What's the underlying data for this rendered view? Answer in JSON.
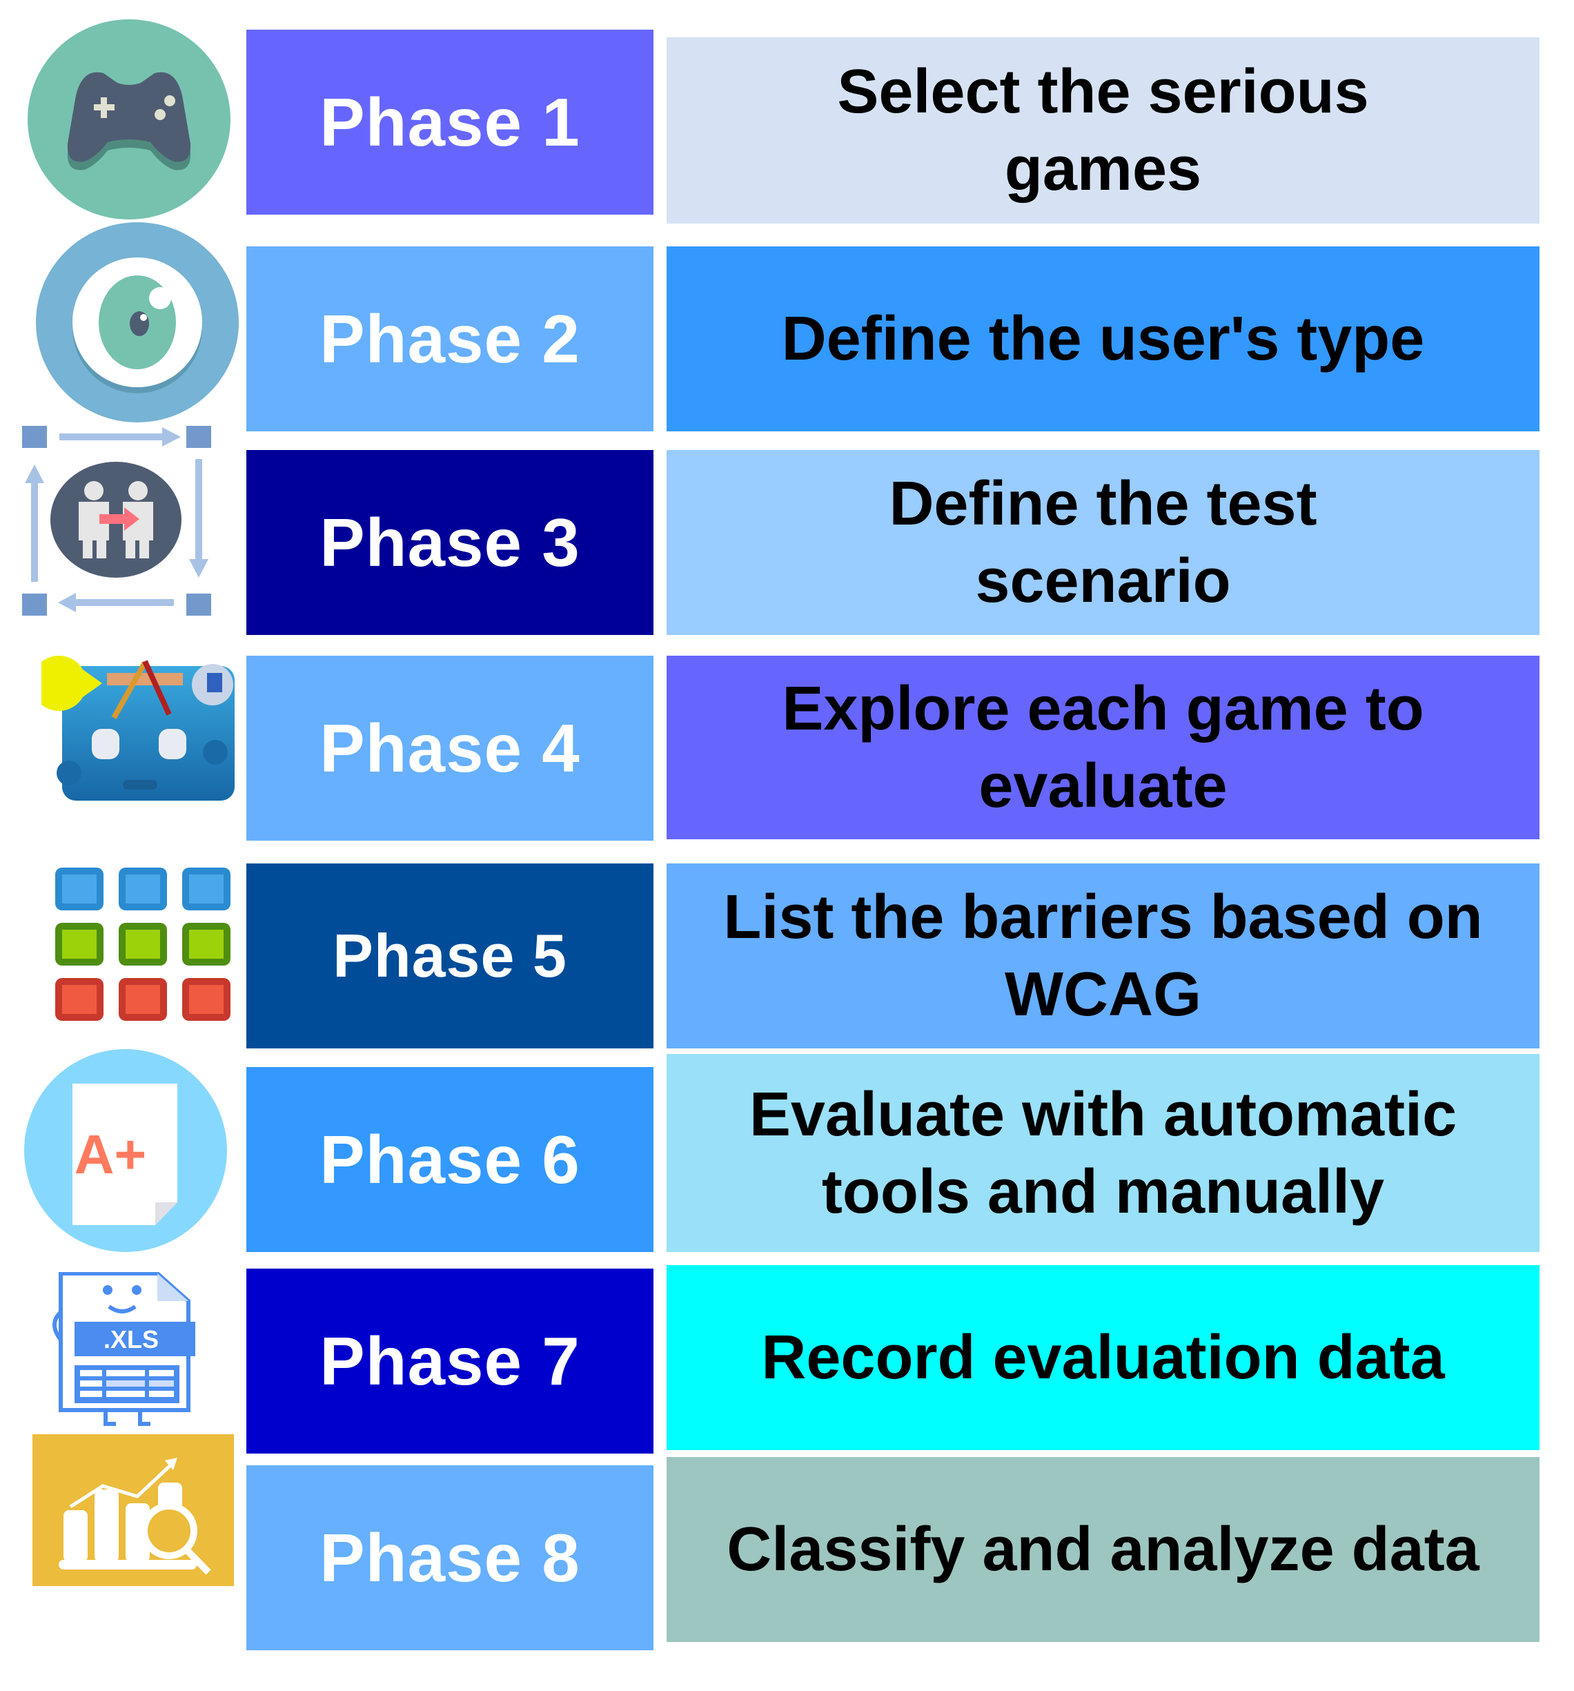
{
  "diagram": {
    "rows": [
      {
        "phase": "Phase 1",
        "description": "Select the serious\ngames",
        "icon": "gamepad-icon",
        "phase_color": "#6666FF",
        "desc_color": "#D6E2F4"
      },
      {
        "phase": "Phase 2",
        "description": "Define the user's type",
        "icon": "eye-icon",
        "phase_color": "#66B0FF",
        "desc_color": "#3399FF"
      },
      {
        "phase": "Phase 3",
        "description": "Define the test\nscenario",
        "icon": "people-exchange-icon",
        "phase_color": "#000099",
        "desc_color": "#99CCFF"
      },
      {
        "phase": "Phase 4",
        "description": "Explore each game to\nevaluate",
        "icon": "games-bag-icon",
        "phase_color": "#66B0FF",
        "desc_color": "#6666FF"
      },
      {
        "phase": "Phase 5",
        "description": "List the barriers based on\nWCAG",
        "icon": "color-grid-icon",
        "phase_color": "#004C99",
        "desc_color": "#66AEFF"
      },
      {
        "phase": "Phase 6",
        "description": "Evaluate with automatic\ntools and manually",
        "icon": "grade-document-icon",
        "phase_color": "#3399FF",
        "desc_color": "#99E0F8"
      },
      {
        "phase": "Phase 7",
        "description": "Record evaluation data",
        "icon": "xls-file-icon",
        "phase_color": "#0000CC",
        "desc_color": "#00FFFF"
      },
      {
        "phase": "Phase 8",
        "description": "Classify and analyze data",
        "icon": "data-analysis-icon",
        "phase_color": "#66B0FF",
        "desc_color": "#9DC6C0"
      }
    ],
    "xls_label": ".XLS",
    "grade_label": "A+"
  }
}
